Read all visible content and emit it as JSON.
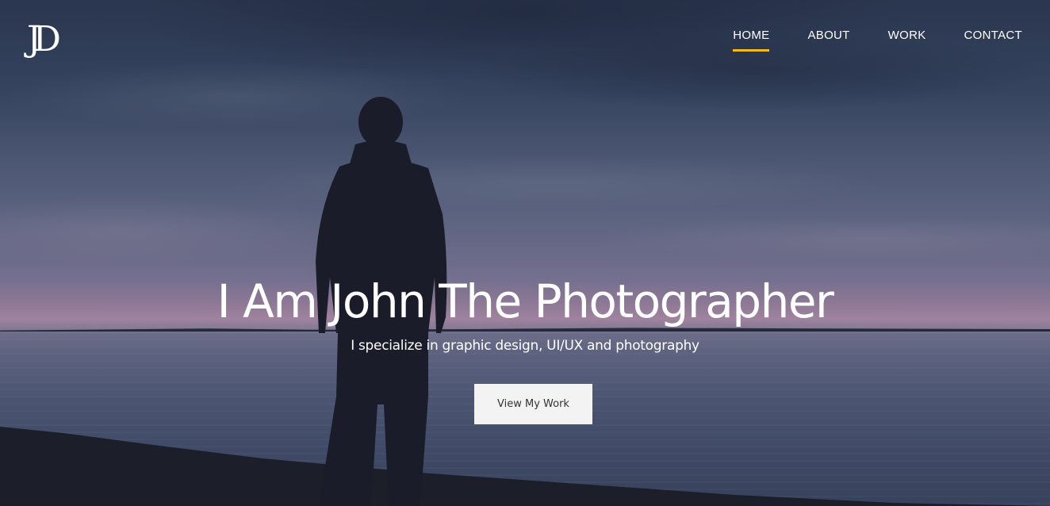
{
  "logo": {
    "text": "JD"
  },
  "nav": {
    "items": [
      {
        "label": "HOME",
        "active": true
      },
      {
        "label": "ABOUT",
        "active": false
      },
      {
        "label": "WORK",
        "active": false
      },
      {
        "label": "CONTACT",
        "active": false
      }
    ]
  },
  "hero": {
    "headline": "I Am John The Photographer",
    "subtitle": "I specialize in graphic design, UI/UX and photography",
    "cta_label": "View My Work"
  },
  "colors": {
    "nav_active_underline": "#f5b91a",
    "button_bg": "#f3f3f3",
    "text": "#ffffff"
  }
}
